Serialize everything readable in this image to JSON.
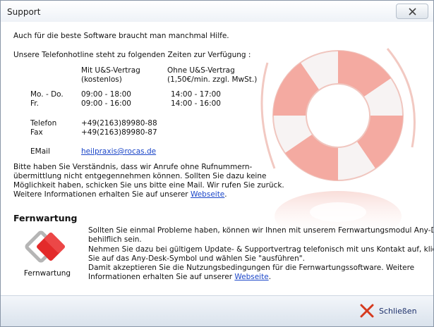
{
  "window": {
    "title": "Support"
  },
  "support": {
    "intro": "Auch für die beste Software braucht man manchmal Hilfe.",
    "hotline_intro": "Unsere Telefonhotline steht zu folgenden Zeiten zur Verfügung :",
    "col1_head1": "Mit U&S-Vertrag",
    "col1_head2": "(kostenlos)",
    "col2_head1": "Ohne U&S-Vertrag",
    "col2_head2": "(1,50€/min. zzgl. MwSt.)",
    "rows": [
      {
        "day": "Mo. - Do.",
        "with": "09:00 - 18:00",
        "without": "14:00 - 17:00"
      },
      {
        "day": "Fr.",
        "with": "09:00 - 16:00",
        "without": "14:00 - 16:00"
      }
    ],
    "phone_label": "Telefon",
    "phone": "+49(2163)89980-88",
    "fax_label": "Fax",
    "fax": "+49(2163)89980-87",
    "email_label": "EMail",
    "email": "heilpraxis@rocas.de",
    "notice_lines": [
      "Bitte haben Sie Verständnis, dass wir Anrufe ohne Rufnummern-",
      "übermittlung nicht entgegennehmen können. Sollten Sie dazu keine",
      "Möglichkeit haben, schicken Sie uns bitte eine Mail. Wir rufen Sie zurück."
    ],
    "more_info_prefix": "Weitere Informationen erhalten Sie auf unserer ",
    "website_link": "Webseite",
    "more_info_suffix": "."
  },
  "remote": {
    "heading": "Fernwartung",
    "icon_label": "Fernwartung",
    "lines": [
      "Sollten Sie einmal Probleme haben, können wir Ihnen mit unserem Fernwartungsmodul Any-Desk",
      "behilflich sein.",
      "Nehmen Sie dazu bei gültigem Update- & Supportvertrag telefonisch mit uns Kontakt auf, klicken",
      "Sie auf das Any-Desk-Symbol und wählen Sie \"ausführen\".",
      "Damit akzeptieren Sie die Nutzungsbedingungen für die Fernwartungssoftware. Weitere"
    ],
    "last_prefix": "Informationen erhalten Sie auf unserer ",
    "website_link": "Webseite",
    "last_suffix": "."
  },
  "footer": {
    "close_label": "Schließen"
  },
  "colors": {
    "link": "#1b46c8",
    "lifebuoy": "#f6b9b0",
    "anydesk_red": "#e32a2a"
  }
}
